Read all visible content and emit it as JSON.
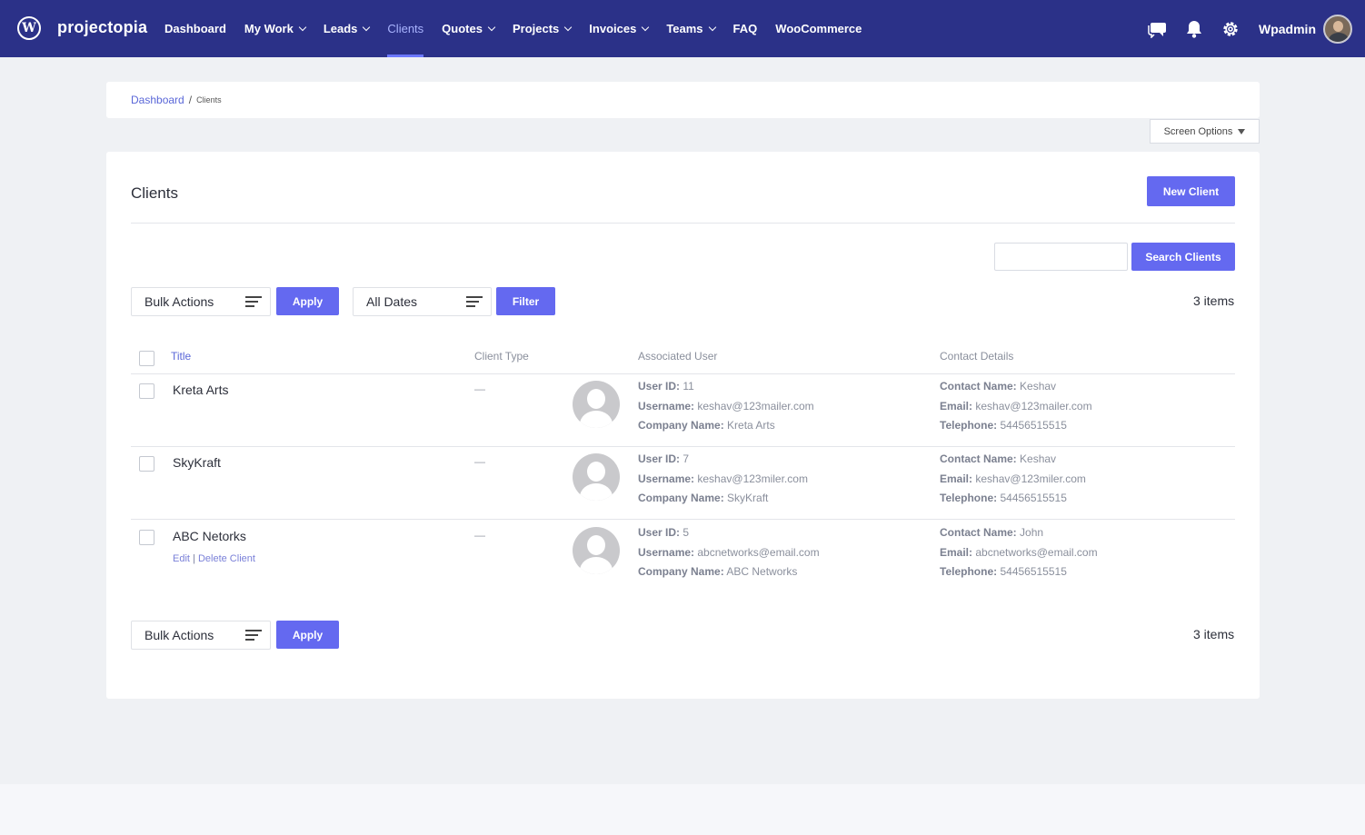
{
  "nav": {
    "brand": "projectopia",
    "menu": [
      {
        "label": "Dashboard",
        "caret": false,
        "active": false
      },
      {
        "label": "My Work",
        "caret": true,
        "active": false
      },
      {
        "label": "Leads",
        "caret": true,
        "active": false
      },
      {
        "label": "Clients",
        "caret": false,
        "active": true
      },
      {
        "label": "Quotes",
        "caret": true,
        "active": false
      },
      {
        "label": "Projects",
        "caret": true,
        "active": false
      },
      {
        "label": "Invoices",
        "caret": true,
        "active": false
      },
      {
        "label": "Teams",
        "caret": true,
        "active": false
      },
      {
        "label": "FAQ",
        "caret": false,
        "active": false
      },
      {
        "label": "WooCommerce",
        "caret": false,
        "active": false
      }
    ],
    "user": "Wpadmin",
    "icons": [
      "chat-icon",
      "bell-icon",
      "gear-icon"
    ]
  },
  "breadcrumb": {
    "root": "Dashboard",
    "separator": "/",
    "current": "Clients"
  },
  "screen_options": "Screen Options",
  "page": {
    "title": "Clients",
    "new_button": "New Client",
    "search_placeholder": "",
    "search_button": "Search Clients",
    "bulk_actions": "Bulk Actions",
    "apply": "Apply",
    "all_dates": "All Dates",
    "filter": "Filter",
    "items_count": "3 items"
  },
  "table": {
    "headers": {
      "title": "Title",
      "client_type": "Client Type",
      "associated_user": "Associated User",
      "contact_details": "Contact Details"
    },
    "labels": {
      "user_id": "User ID:",
      "username": "Username:",
      "company": "Company Name:",
      "contact_name": "Contact Name:",
      "email": "Email:",
      "telephone": "Telephone:"
    },
    "rows": [
      {
        "name": "Kreta Arts",
        "client_type": "—",
        "user_id": "11",
        "username": "keshav@123mailer.com",
        "company": "Kreta Arts",
        "contact_name": "Keshav",
        "email": "keshav@123mailer.com",
        "telephone": "54456515515"
      },
      {
        "name": "SkyKraft",
        "client_type": "—",
        "user_id": "7",
        "username": "keshav@123miler.com",
        "company": "SkyKraft",
        "contact_name": "Keshav",
        "email": "keshav@123miler.com",
        "telephone": "54456515515"
      },
      {
        "name": "ABC Netorks",
        "client_type": "—",
        "user_id": "5",
        "username": "abcnetworks@email.com",
        "company": "ABC Networks",
        "contact_name": "John",
        "email": "abcnetworks@email.com",
        "telephone": "54456515515"
      }
    ],
    "row_actions": {
      "edit": "Edit",
      "separator": "|",
      "delete": "Delete Client"
    }
  },
  "colors": {
    "nav_bg": "#2b3188",
    "accent": "#6469f0",
    "link": "#5a67d8",
    "page_bg": "#eff1f4"
  }
}
